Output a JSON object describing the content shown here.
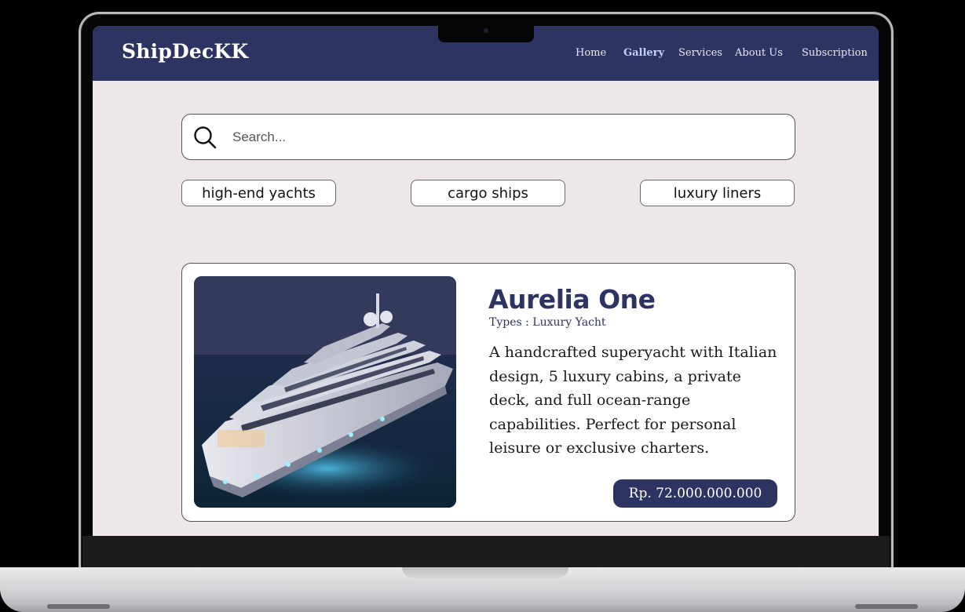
{
  "navbar": {
    "logo": "ShipDecKK",
    "links": [
      {
        "label": "Home",
        "active": false
      },
      {
        "label": "Gallery",
        "active": true
      },
      {
        "label": "Services",
        "active": false
      },
      {
        "label": "About Us",
        "active": false
      },
      {
        "label": "Subscription",
        "active": false
      }
    ]
  },
  "search": {
    "placeholder": "Search...",
    "icon": "search-icon"
  },
  "filters": [
    "high-end yachts",
    "cargo ships",
    "luxury liners"
  ],
  "card": {
    "title": "Aurelia One",
    "type": "Types : Luxury Yacht",
    "description": "A handcrafted superyacht with Italian design, 5 luxury cabins, a private deck, and full ocean-range capabilities. Perfect for personal leisure or exclusive charters.",
    "price": "Rp. 72.000.000.000",
    "image": "luxury-yacht-photo"
  },
  "colors": {
    "navbar": "#2e3461",
    "page_background": "#eee7e7",
    "accent": "#2e3461",
    "active_link": "#c4cffb"
  }
}
